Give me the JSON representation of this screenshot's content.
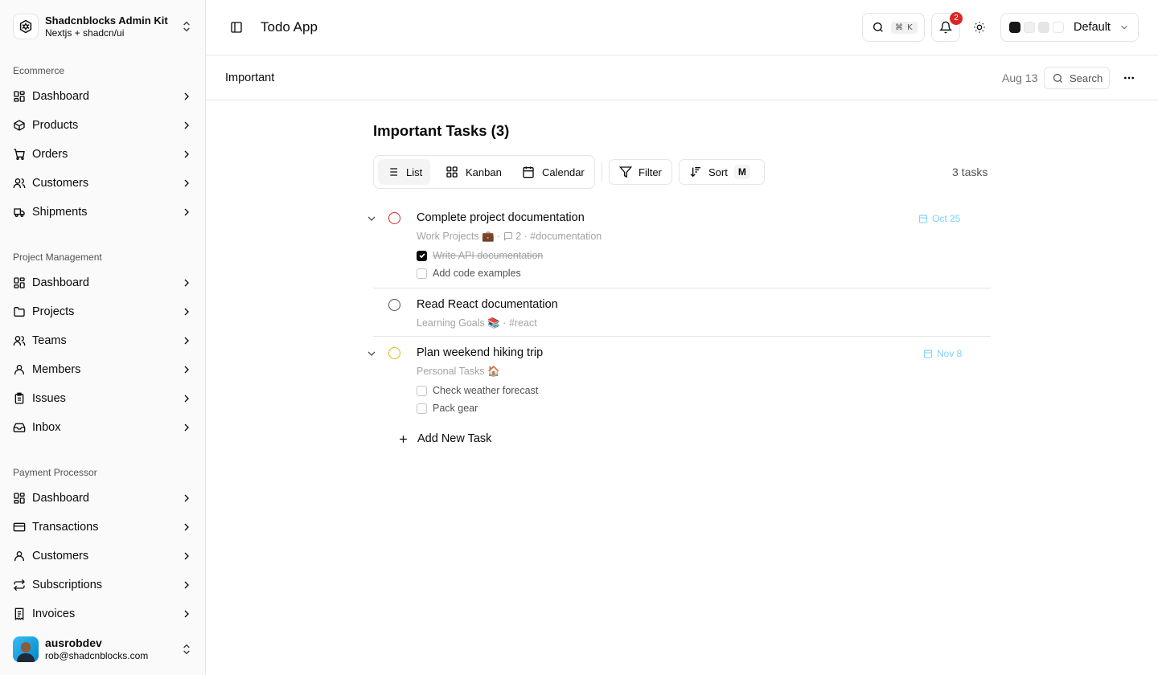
{
  "brand": {
    "title": "Shadcnblocks Admin Kit",
    "subtitle": "Nextjs + shadcn/ui"
  },
  "sidebar": {
    "groups": [
      {
        "label": "Ecommerce",
        "items": [
          {
            "label": "Dashboard",
            "icon": "dashboard-icon"
          },
          {
            "label": "Products",
            "icon": "box-icon"
          },
          {
            "label": "Orders",
            "icon": "cart-icon"
          },
          {
            "label": "Customers",
            "icon": "users-icon"
          },
          {
            "label": "Shipments",
            "icon": "truck-icon"
          }
        ]
      },
      {
        "label": "Project Management",
        "items": [
          {
            "label": "Dashboard",
            "icon": "dashboard-icon"
          },
          {
            "label": "Projects",
            "icon": "folder-icon"
          },
          {
            "label": "Teams",
            "icon": "users-icon"
          },
          {
            "label": "Members",
            "icon": "user-icon"
          },
          {
            "label": "Issues",
            "icon": "clipboard-icon"
          },
          {
            "label": "Inbox",
            "icon": "inbox-icon"
          }
        ]
      },
      {
        "label": "Payment Processor",
        "items": [
          {
            "label": "Dashboard",
            "icon": "dashboard-icon"
          },
          {
            "label": "Transactions",
            "icon": "credit-card-icon"
          },
          {
            "label": "Customers",
            "icon": "user-icon"
          },
          {
            "label": "Subscriptions",
            "icon": "repeat-icon"
          },
          {
            "label": "Invoices",
            "icon": "receipt-icon"
          }
        ]
      }
    ]
  },
  "user": {
    "name": "ausrobdev",
    "email": "rob@shadcnblocks.com"
  },
  "header": {
    "title": "Todo App",
    "search_kbd": "⌘ K",
    "notification_count": "2",
    "theme_label": "Default",
    "swatches": [
      "#171717",
      "#f0f0f0",
      "#e5e5e5",
      "#ffffff"
    ]
  },
  "subheader": {
    "title": "Important",
    "date": "Aug 13",
    "search_label": "Search"
  },
  "main": {
    "title": "Important Tasks (3)",
    "tabs": {
      "list": "List",
      "kanban": "Kanban",
      "calendar": "Calendar"
    },
    "filter": "Filter",
    "sort": "Sort",
    "sort_kbd": "M",
    "count": "3 tasks",
    "add_task": "Add New Task"
  },
  "tasks": [
    {
      "title": "Complete project documentation",
      "project": "Work Projects 💼",
      "comments": "2",
      "tag": "#documentation",
      "due": "Oct 25",
      "priority_color": "#dc2626",
      "subtasks": [
        {
          "label": "Write API documentation",
          "done": true
        },
        {
          "label": "Add code examples",
          "done": false
        }
      ]
    },
    {
      "title": "Read React documentation",
      "project": "Learning Goals 📚",
      "tag": "#react",
      "priority_color": "#525252"
    },
    {
      "title": "Plan weekend hiking trip",
      "project": "Personal Tasks 🏠",
      "due": "Nov 8",
      "priority_color": "#eab308",
      "subtasks": [
        {
          "label": "Check weather forecast",
          "done": false
        },
        {
          "label": "Pack gear",
          "done": false
        }
      ]
    }
  ]
}
